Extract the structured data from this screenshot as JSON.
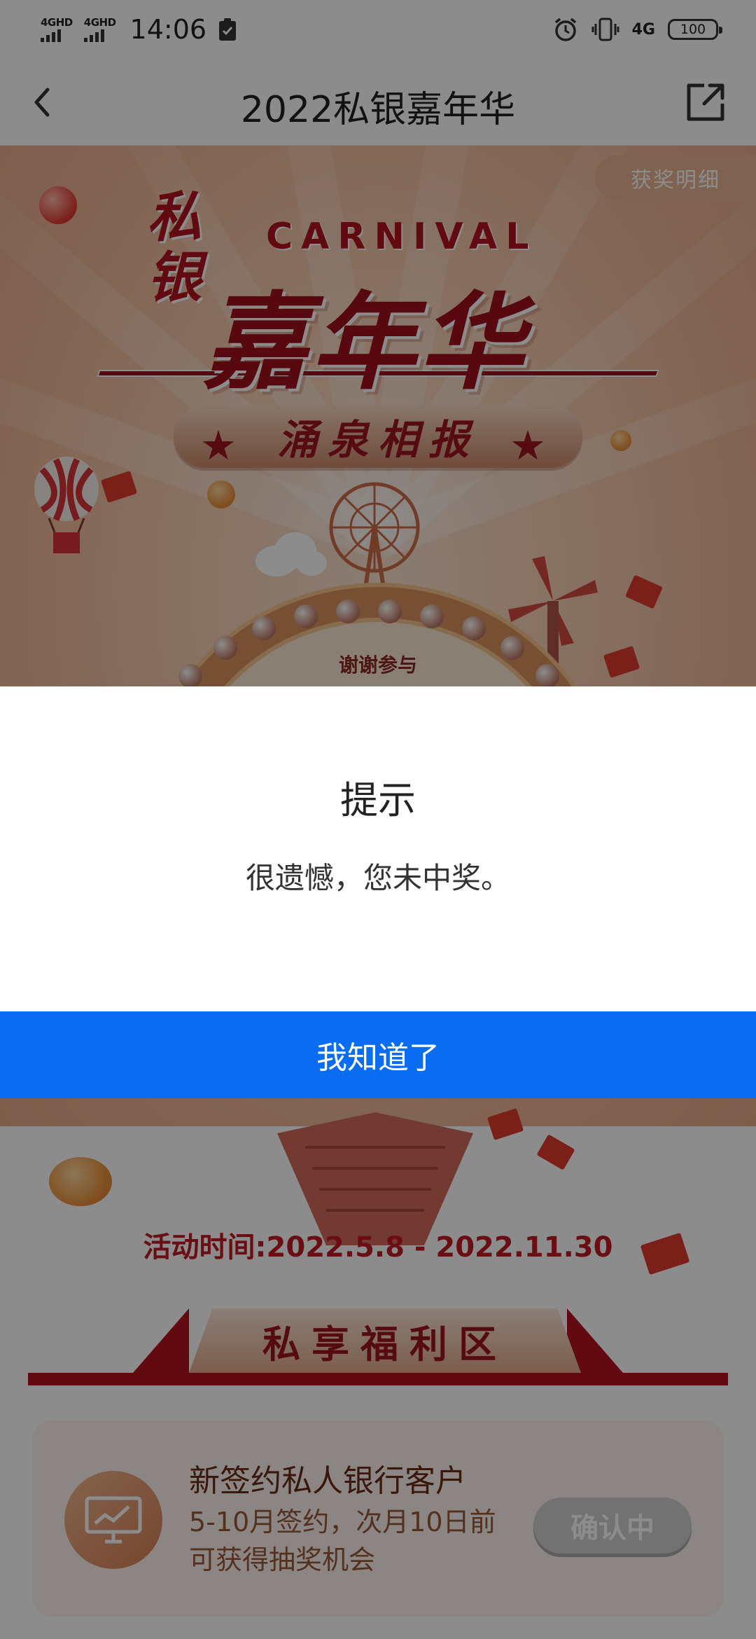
{
  "status_bar": {
    "signal_1": "4GHD",
    "signal_2": "4GHD",
    "time": "14:06",
    "network": "4G",
    "battery": "100"
  },
  "nav": {
    "title": "2022私银嘉年华",
    "back_icon": "chevron-left-icon",
    "share_icon": "share-icon"
  },
  "hero": {
    "award_detail": "获奖明细",
    "logo_side": "私银",
    "logo_carnival": "CARNIVAL",
    "logo_main": "嘉年华",
    "banner": "涌泉相报",
    "wheel_text": "谢谢参与"
  },
  "activity_time": "活动时间:2022.5.8 - 2022.11.30",
  "section_title": "私享福利区",
  "benefit": {
    "title": "新签约私人银行客户",
    "desc": "5-10月签约，次月10日前可获得抽奖机会",
    "button": "确认中",
    "icon": "monitor-chart-icon"
  },
  "dialog": {
    "title": "提示",
    "message": "很遗憾，您未中奖。",
    "confirm": "我知道了"
  },
  "colors": {
    "accent_blue": "#0a6cf0",
    "brand_red": "#b3121f"
  }
}
